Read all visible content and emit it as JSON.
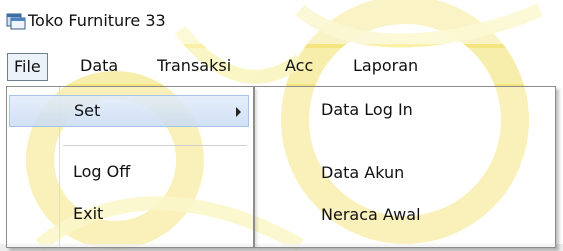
{
  "window": {
    "title": "Toko Furniture 33",
    "icon": "app-window-icon"
  },
  "menubar": {
    "items": [
      {
        "label": "File"
      },
      {
        "label": "Data"
      },
      {
        "label": "Transaksi"
      },
      {
        "label": "Acc"
      },
      {
        "label": "Laporan"
      }
    ]
  },
  "file_menu": {
    "items": [
      {
        "label": "Set",
        "has_submenu": true
      },
      {
        "label": "Log Off"
      },
      {
        "label": "Exit"
      }
    ]
  },
  "set_submenu": {
    "items": [
      {
        "label": "Data Log In"
      },
      {
        "label": "Data Akun"
      },
      {
        "label": "Neraca Awal"
      }
    ]
  },
  "colors": {
    "accent": "#c9dbf3",
    "watermark": "#f2e06a"
  }
}
